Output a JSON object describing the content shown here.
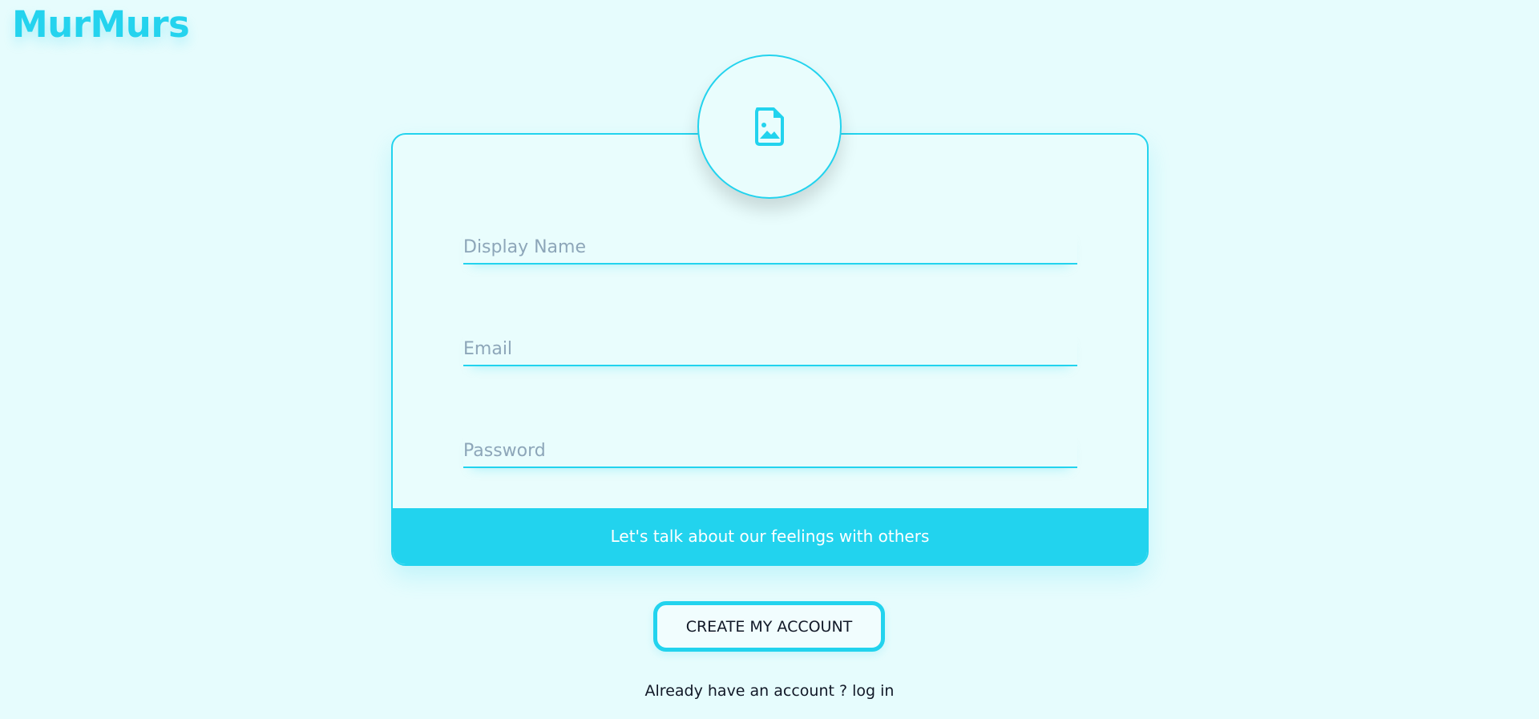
{
  "app": {
    "title": "MurMurs"
  },
  "avatar": {
    "icon": "image-file-icon",
    "color": "#22d3ee"
  },
  "form": {
    "display_name": {
      "placeholder": "Display Name",
      "value": ""
    },
    "email": {
      "placeholder": "Email",
      "value": ""
    },
    "password": {
      "placeholder": "Password",
      "value": ""
    },
    "tagline": "Let's talk about our feelings with others"
  },
  "actions": {
    "create_label": "CREATE MY ACCOUNT",
    "login_prompt": "Already have an account ? ",
    "login_link": "log in"
  },
  "colors": {
    "accent": "#22d3ee",
    "background": "#e6fcfd"
  }
}
